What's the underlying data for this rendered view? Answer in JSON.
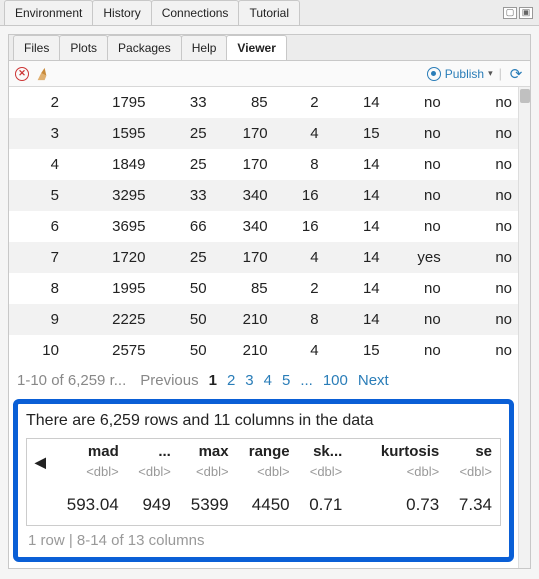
{
  "topTabs": [
    "Environment",
    "History",
    "Connections",
    "Tutorial"
  ],
  "innerTabs": [
    "Files",
    "Plots",
    "Packages",
    "Help",
    "Viewer"
  ],
  "activeInnerTab": "Viewer",
  "publishLabel": "Publish",
  "table": {
    "rows": [
      [
        "2",
        "1795",
        "33",
        "85",
        "2",
        "14",
        "no",
        "no"
      ],
      [
        "3",
        "1595",
        "25",
        "170",
        "4",
        "15",
        "no",
        "no"
      ],
      [
        "4",
        "1849",
        "25",
        "170",
        "8",
        "14",
        "no",
        "no"
      ],
      [
        "5",
        "3295",
        "33",
        "340",
        "16",
        "14",
        "no",
        "no"
      ],
      [
        "6",
        "3695",
        "66",
        "340",
        "16",
        "14",
        "no",
        "no"
      ],
      [
        "7",
        "1720",
        "25",
        "170",
        "4",
        "14",
        "yes",
        "no"
      ],
      [
        "8",
        "1995",
        "50",
        "85",
        "2",
        "14",
        "no",
        "no"
      ],
      [
        "9",
        "2225",
        "50",
        "210",
        "8",
        "14",
        "no",
        "no"
      ],
      [
        "10",
        "2575",
        "50",
        "210",
        "4",
        "15",
        "no",
        "no"
      ]
    ]
  },
  "pager": {
    "status": "1-10 of 6,259 r...",
    "prev": "Previous",
    "pages": [
      "1",
      "2",
      "3",
      "4",
      "5"
    ],
    "ellipsis": "...",
    "last": "100",
    "next": "Next"
  },
  "summary": {
    "title": "There are 6,259 rows and 11 columns in the data",
    "cols": [
      "mad",
      "...",
      "max",
      "range",
      "sk...",
      "",
      "kurtosis",
      "se"
    ],
    "types": [
      "<dbl>",
      "<dbl>",
      "<dbl>",
      "<dbl>",
      "<dbl>",
      "",
      "<dbl>",
      "<dbl>"
    ],
    "vals": [
      "593.04",
      "949",
      "5399",
      "4450",
      "0.71",
      "",
      "0.73",
      "7.34"
    ],
    "footer": "1 row | 8-14 of 13 columns"
  }
}
